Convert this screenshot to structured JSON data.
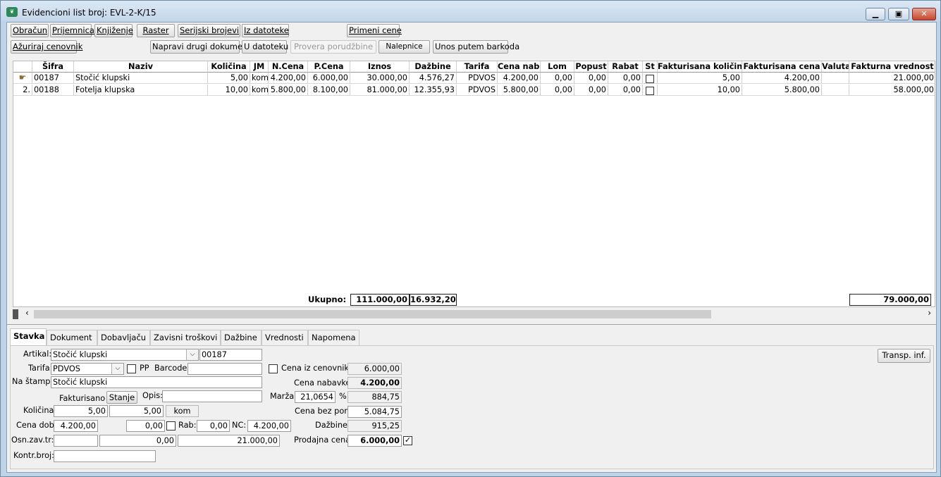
{
  "window": {
    "title": "Evidencioni list broj: EVL-2-K/15",
    "icon": "app-logo-icon"
  },
  "toolbar": {
    "row1": [
      "Obračun",
      "Prijemnica",
      "Knjiženje",
      "Raster",
      "Serijski brojevi",
      "Iz datoteke",
      "Primeni cene"
    ],
    "row2": [
      "Ažuriraj cenovnik",
      "Napravi drugi dokument",
      "U datoteku",
      "Provera porudžbine",
      "Nalepnice",
      "Unos putem barkoda"
    ]
  },
  "grid": {
    "headers": [
      "Šifra",
      "Naziv",
      "Količina",
      "JM",
      "N.Cena",
      "P.Cena",
      "Iznos",
      "Dažbine",
      "Tarifa",
      "Cena nab.",
      "Lom",
      "Popust",
      "Rabat",
      "St",
      "Fakturisana količina",
      "Fakturisana cena",
      "Valuta",
      "Fakturna vrednost"
    ],
    "rows": [
      {
        "num": "",
        "sifra": "00187",
        "naziv": "Stočić klupski",
        "kolicina": "5,00",
        "jm": "kom",
        "ncena": "4.200,00",
        "pcena": "6.000,00",
        "iznos": "30.000,00",
        "dazbine": "4.576,27",
        "tarifa": "PDVOS",
        "cenanab": "4.200,00",
        "lom": "0,00",
        "popust": "0,00",
        "rabat": "0,00",
        "fkol": "5,00",
        "fcena": "4.200,00",
        "valuta": "",
        "fvred": "21.000,00"
      },
      {
        "num": "2.",
        "sifra": "00188",
        "naziv": "Fotelja klupska",
        "kolicina": "10,00",
        "jm": "kom",
        "ncena": "5.800,00",
        "pcena": "8.100,00",
        "iznos": "81.000,00",
        "dazbine": "12.355,93",
        "tarifa": "PDVOS",
        "cenanab": "5.800,00",
        "lom": "0,00",
        "popust": "0,00",
        "rabat": "0,00",
        "fkol": "10,00",
        "fcena": "5.800,00",
        "valuta": "",
        "fvred": "58.000,00"
      }
    ],
    "totals": {
      "label": "Ukupno:",
      "iznos": "111.000,00",
      "dazbine": "16.932,20",
      "fvred": "79.000,00"
    }
  },
  "tabs": [
    "Stavka",
    "Dokument",
    "Dobavljaču",
    "Zavisni troškovi",
    "Dažbine",
    "Vrednosti",
    "Napomena"
  ],
  "form": {
    "artikal_label": "Artikal:",
    "artikal": "Stočić klupski",
    "artikal_code": "00187",
    "tarifa_label": "Tarifa:",
    "tarifa": "PDVOS",
    "pp_label": "PP",
    "barcode_label": "Barcode:",
    "barcode": "",
    "nastampi_label": "Na štampi:",
    "nastampi": "Stočić klupski",
    "fakturisano_label": "Fakturisano",
    "stanje_label": "Stanje",
    "opis_label": "Opis:",
    "opis": "",
    "kolicina_label": "Količina:",
    "kolicina1": "5,00",
    "kolicina2": "5,00",
    "jm": "kom",
    "cenadob_label": "Cena dob:",
    "cenadob": "4.200,00",
    "cenadob2": "0,00",
    "rab_label": "Rab:",
    "rab": "0,00",
    "nc_label": "NC:",
    "nc": "4.200,00",
    "osnzav_label": "Osn.zav.tr:",
    "osnzav1": "",
    "osnzav2": "0,00",
    "osnzav3": "21.000,00",
    "kontr_label": "Kontr.broj:",
    "kontr": "",
    "cenaizcen_label": "Cena iz cenovnika:",
    "cenaizcen": "6.000,00",
    "cenanab_label": "Cena nabavke:",
    "cenanab": "4.200,00",
    "marza_label": "Marža:",
    "marza": "21,0654",
    "marza_pct": "%",
    "marza_val": "884,75",
    "cenabezpor_label": "Cena bez por.:",
    "cenabezpor": "5.084,75",
    "dazbine_label": "Dažbine:",
    "dazbine": "915,25",
    "prodajna_label": "Prodajna cena:",
    "prodajna": "6.000,00",
    "transp_label": "Transp. inf."
  }
}
